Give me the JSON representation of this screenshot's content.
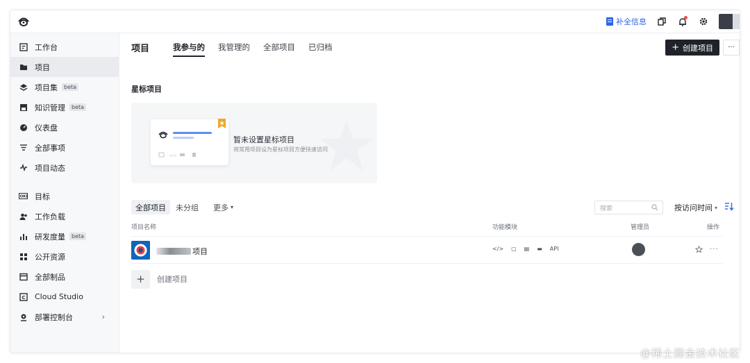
{
  "topbar": {
    "complete_info": "补全信息"
  },
  "sidebar": {
    "items": [
      {
        "label": "工作台",
        "icon": "dashboard-icon"
      },
      {
        "label": "项目",
        "icon": "folder-icon"
      },
      {
        "label": "项目集",
        "icon": "layers-icon",
        "badge": "beta"
      },
      {
        "label": "知识管理",
        "icon": "save-icon",
        "badge": "beta"
      },
      {
        "label": "仪表盘",
        "icon": "gauge-icon"
      },
      {
        "label": "全部事项",
        "icon": "filter-icon"
      },
      {
        "label": "项目动态",
        "icon": "activity-icon"
      },
      {
        "label": "目标",
        "icon": "okr-icon"
      },
      {
        "label": "工作负载",
        "icon": "users-icon"
      },
      {
        "label": "研发度量",
        "icon": "bar-chart-icon",
        "badge": "beta"
      },
      {
        "label": "公开资源",
        "icon": "grid-icon"
      },
      {
        "label": "全部制品",
        "icon": "box-icon"
      },
      {
        "label": "Cloud Studio",
        "icon": "cloud-studio-icon"
      },
      {
        "label": "部署控制台",
        "icon": "deploy-icon"
      }
    ]
  },
  "main": {
    "title": "项目",
    "tabs": [
      "我参与的",
      "我管理的",
      "全部项目",
      "已归档"
    ],
    "create_button": "创建项目",
    "more_button": "···",
    "starred_title": "星标项目",
    "empty_title": "暂未设置星标项目",
    "empty_desc": "将常用项目设为星标项目方便快速访问",
    "filter_tabs": [
      "全部项目",
      "未分组",
      "更多"
    ],
    "search_placeholder": "搜索",
    "sort_label": "按访问时间",
    "table": {
      "headers": [
        "项目名称",
        "功能模块",
        "管理员",
        "操作"
      ],
      "rows": [
        {
          "name_suffix": "项目",
          "modules": [
            "</>",
            "▢",
            "▤",
            "▬",
            "API"
          ]
        }
      ]
    },
    "new_project": "创建项目"
  },
  "watermark": "@稀土掘金技术社区",
  "colors": {
    "accent": "#2f64e8",
    "primary_button": "#1f2329",
    "sidebar_bg": "#f7f8fa"
  }
}
